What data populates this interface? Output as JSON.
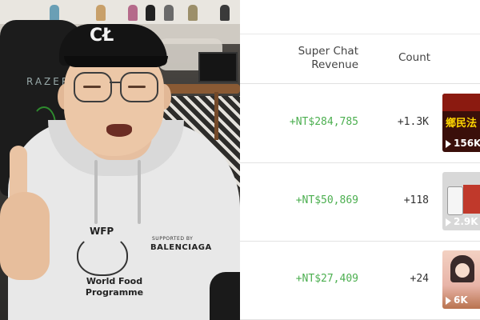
{
  "video": {
    "chair_brand": "RAZER",
    "cap_logo": "CŁ",
    "shirt": {
      "org_short": "WFP",
      "org_name_line1": "World Food",
      "org_name_line2": "Programme",
      "supported_by": "SUPPORTED BY",
      "brand": "BALENCIAGA"
    }
  },
  "table": {
    "columns": {
      "revenue_line1": "Super Chat",
      "revenue_line2": "Revenue",
      "count": "Count"
    },
    "rows": [
      {
        "revenue": "+NT$284,785",
        "count": "+1.3K",
        "thumb_views": "156K",
        "thumb_text": "鄉民法",
        "thumb_bg": "#3a0f0a"
      },
      {
        "revenue": "+NT$50,869",
        "count": "+118",
        "thumb_views": "2.9K",
        "thumb_text": "",
        "thumb_bg": "#d8d8d8"
      },
      {
        "revenue": "+NT$27,409",
        "count": "+24",
        "thumb_views": "6K",
        "thumb_text": "",
        "thumb_bg": "#e8b4a8"
      }
    ]
  },
  "colors": {
    "revenue_green": "#4caf50",
    "header_text": "#444444"
  }
}
